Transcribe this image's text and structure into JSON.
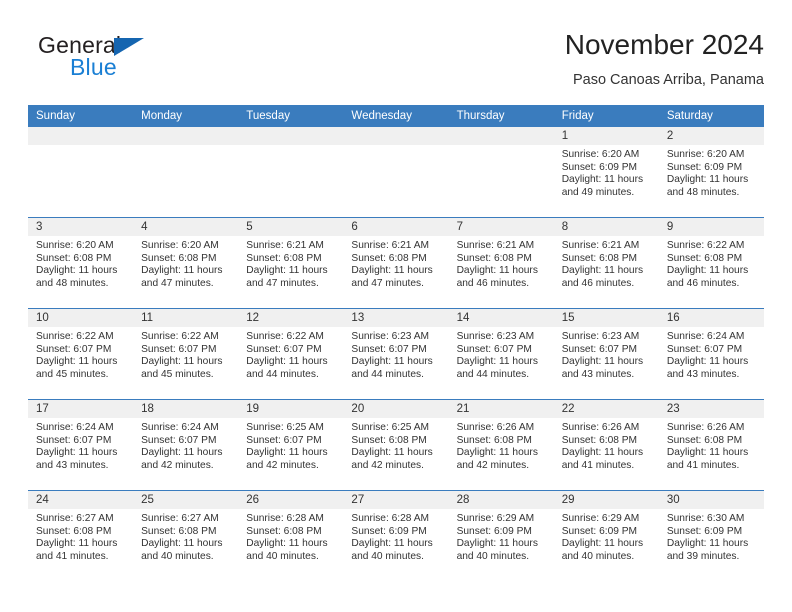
{
  "brand": {
    "name_part1": "General",
    "name_part2": "Blue",
    "flag_icon": "triangle-flag-icon"
  },
  "header": {
    "month_title": "November 2024",
    "location": "Paso Canoas Arriba, Panama"
  },
  "colors": {
    "header_blue": "#3a7cbe",
    "daynum_gray": "#f0f0f0",
    "brand_blue": "#1a7fd4",
    "flag_blue": "#1565b0",
    "text": "#333333"
  },
  "calendar": {
    "weekdays": [
      "Sunday",
      "Monday",
      "Tuesday",
      "Wednesday",
      "Thursday",
      "Friday",
      "Saturday"
    ],
    "weeks": [
      [
        {
          "day": "",
          "blank": true,
          "sunrise": "",
          "sunset": "",
          "daylight": ""
        },
        {
          "day": "",
          "blank": true,
          "sunrise": "",
          "sunset": "",
          "daylight": ""
        },
        {
          "day": "",
          "blank": true,
          "sunrise": "",
          "sunset": "",
          "daylight": ""
        },
        {
          "day": "",
          "blank": true,
          "sunrise": "",
          "sunset": "",
          "daylight": ""
        },
        {
          "day": "",
          "blank": true,
          "sunrise": "",
          "sunset": "",
          "daylight": ""
        },
        {
          "day": "1",
          "blank": false,
          "sunrise": "Sunrise: 6:20 AM",
          "sunset": "Sunset: 6:09 PM",
          "daylight": "Daylight: 11 hours and 49 minutes."
        },
        {
          "day": "2",
          "blank": false,
          "sunrise": "Sunrise: 6:20 AM",
          "sunset": "Sunset: 6:09 PM",
          "daylight": "Daylight: 11 hours and 48 minutes."
        }
      ],
      [
        {
          "day": "3",
          "blank": false,
          "sunrise": "Sunrise: 6:20 AM",
          "sunset": "Sunset: 6:08 PM",
          "daylight": "Daylight: 11 hours and 48 minutes."
        },
        {
          "day": "4",
          "blank": false,
          "sunrise": "Sunrise: 6:20 AM",
          "sunset": "Sunset: 6:08 PM",
          "daylight": "Daylight: 11 hours and 47 minutes."
        },
        {
          "day": "5",
          "blank": false,
          "sunrise": "Sunrise: 6:21 AM",
          "sunset": "Sunset: 6:08 PM",
          "daylight": "Daylight: 11 hours and 47 minutes."
        },
        {
          "day": "6",
          "blank": false,
          "sunrise": "Sunrise: 6:21 AM",
          "sunset": "Sunset: 6:08 PM",
          "daylight": "Daylight: 11 hours and 47 minutes."
        },
        {
          "day": "7",
          "blank": false,
          "sunrise": "Sunrise: 6:21 AM",
          "sunset": "Sunset: 6:08 PM",
          "daylight": "Daylight: 11 hours and 46 minutes."
        },
        {
          "day": "8",
          "blank": false,
          "sunrise": "Sunrise: 6:21 AM",
          "sunset": "Sunset: 6:08 PM",
          "daylight": "Daylight: 11 hours and 46 minutes."
        },
        {
          "day": "9",
          "blank": false,
          "sunrise": "Sunrise: 6:22 AM",
          "sunset": "Sunset: 6:08 PM",
          "daylight": "Daylight: 11 hours and 46 minutes."
        }
      ],
      [
        {
          "day": "10",
          "blank": false,
          "sunrise": "Sunrise: 6:22 AM",
          "sunset": "Sunset: 6:07 PM",
          "daylight": "Daylight: 11 hours and 45 minutes."
        },
        {
          "day": "11",
          "blank": false,
          "sunrise": "Sunrise: 6:22 AM",
          "sunset": "Sunset: 6:07 PM",
          "daylight": "Daylight: 11 hours and 45 minutes."
        },
        {
          "day": "12",
          "blank": false,
          "sunrise": "Sunrise: 6:22 AM",
          "sunset": "Sunset: 6:07 PM",
          "daylight": "Daylight: 11 hours and 44 minutes."
        },
        {
          "day": "13",
          "blank": false,
          "sunrise": "Sunrise: 6:23 AM",
          "sunset": "Sunset: 6:07 PM",
          "daylight": "Daylight: 11 hours and 44 minutes."
        },
        {
          "day": "14",
          "blank": false,
          "sunrise": "Sunrise: 6:23 AM",
          "sunset": "Sunset: 6:07 PM",
          "daylight": "Daylight: 11 hours and 44 minutes."
        },
        {
          "day": "15",
          "blank": false,
          "sunrise": "Sunrise: 6:23 AM",
          "sunset": "Sunset: 6:07 PM",
          "daylight": "Daylight: 11 hours and 43 minutes."
        },
        {
          "day": "16",
          "blank": false,
          "sunrise": "Sunrise: 6:24 AM",
          "sunset": "Sunset: 6:07 PM",
          "daylight": "Daylight: 11 hours and 43 minutes."
        }
      ],
      [
        {
          "day": "17",
          "blank": false,
          "sunrise": "Sunrise: 6:24 AM",
          "sunset": "Sunset: 6:07 PM",
          "daylight": "Daylight: 11 hours and 43 minutes."
        },
        {
          "day": "18",
          "blank": false,
          "sunrise": "Sunrise: 6:24 AM",
          "sunset": "Sunset: 6:07 PM",
          "daylight": "Daylight: 11 hours and 42 minutes."
        },
        {
          "day": "19",
          "blank": false,
          "sunrise": "Sunrise: 6:25 AM",
          "sunset": "Sunset: 6:07 PM",
          "daylight": "Daylight: 11 hours and 42 minutes."
        },
        {
          "day": "20",
          "blank": false,
          "sunrise": "Sunrise: 6:25 AM",
          "sunset": "Sunset: 6:08 PM",
          "daylight": "Daylight: 11 hours and 42 minutes."
        },
        {
          "day": "21",
          "blank": false,
          "sunrise": "Sunrise: 6:26 AM",
          "sunset": "Sunset: 6:08 PM",
          "daylight": "Daylight: 11 hours and 42 minutes."
        },
        {
          "day": "22",
          "blank": false,
          "sunrise": "Sunrise: 6:26 AM",
          "sunset": "Sunset: 6:08 PM",
          "daylight": "Daylight: 11 hours and 41 minutes."
        },
        {
          "day": "23",
          "blank": false,
          "sunrise": "Sunrise: 6:26 AM",
          "sunset": "Sunset: 6:08 PM",
          "daylight": "Daylight: 11 hours and 41 minutes."
        }
      ],
      [
        {
          "day": "24",
          "blank": false,
          "sunrise": "Sunrise: 6:27 AM",
          "sunset": "Sunset: 6:08 PM",
          "daylight": "Daylight: 11 hours and 41 minutes."
        },
        {
          "day": "25",
          "blank": false,
          "sunrise": "Sunrise: 6:27 AM",
          "sunset": "Sunset: 6:08 PM",
          "daylight": "Daylight: 11 hours and 40 minutes."
        },
        {
          "day": "26",
          "blank": false,
          "sunrise": "Sunrise: 6:28 AM",
          "sunset": "Sunset: 6:08 PM",
          "daylight": "Daylight: 11 hours and 40 minutes."
        },
        {
          "day": "27",
          "blank": false,
          "sunrise": "Sunrise: 6:28 AM",
          "sunset": "Sunset: 6:09 PM",
          "daylight": "Daylight: 11 hours and 40 minutes."
        },
        {
          "day": "28",
          "blank": false,
          "sunrise": "Sunrise: 6:29 AM",
          "sunset": "Sunset: 6:09 PM",
          "daylight": "Daylight: 11 hours and 40 minutes."
        },
        {
          "day": "29",
          "blank": false,
          "sunrise": "Sunrise: 6:29 AM",
          "sunset": "Sunset: 6:09 PM",
          "daylight": "Daylight: 11 hours and 40 minutes."
        },
        {
          "day": "30",
          "blank": false,
          "sunrise": "Sunrise: 6:30 AM",
          "sunset": "Sunset: 6:09 PM",
          "daylight": "Daylight: 11 hours and 39 minutes."
        }
      ]
    ]
  }
}
